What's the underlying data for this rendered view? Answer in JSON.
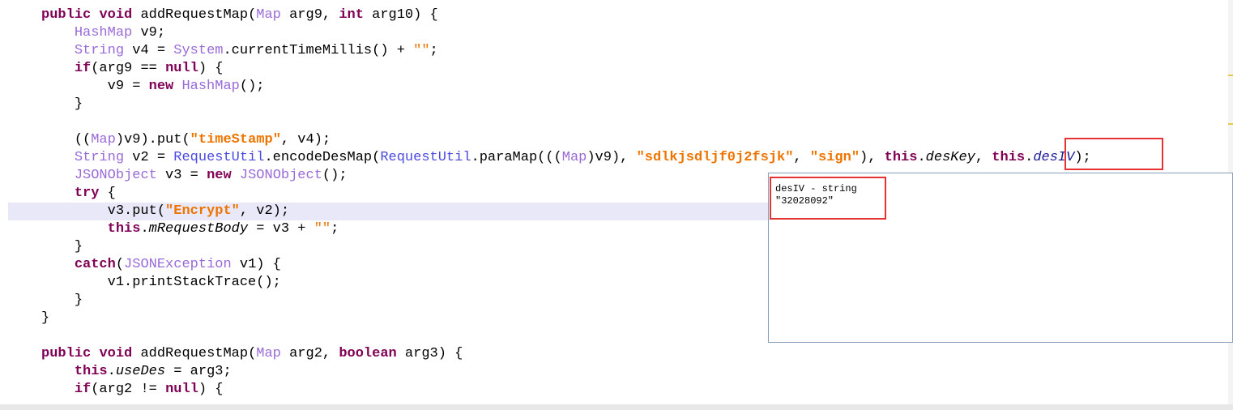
{
  "code_lines": [
    [
      [
        "public",
        "kw"
      ],
      [
        " ",
        ""
      ],
      [
        "void",
        "kw"
      ],
      [
        " addRequestMap(",
        ""
      ],
      [
        "Map",
        "tp"
      ],
      [
        " arg9, ",
        ""
      ],
      [
        "int",
        "kw"
      ],
      [
        " arg10) {",
        ""
      ]
    ],
    [
      [
        "HashMap",
        "tp"
      ],
      [
        " v9;",
        ""
      ]
    ],
    [
      [
        "String",
        "tp"
      ],
      [
        " v4 = ",
        ""
      ],
      [
        "System",
        "tp"
      ],
      [
        ".currentTimeMillis() + ",
        ""
      ],
      [
        "\"\"",
        "sp"
      ],
      [
        ";",
        ""
      ]
    ],
    [
      [
        "if",
        "kw"
      ],
      [
        "(arg9 == ",
        ""
      ],
      [
        "null",
        "kw"
      ],
      [
        ") {",
        ""
      ]
    ],
    [
      [
        "v9 = ",
        ""
      ],
      [
        "new",
        "kw"
      ],
      [
        " ",
        ""
      ],
      [
        "HashMap",
        "tp"
      ],
      [
        "();",
        ""
      ]
    ],
    [
      [
        "}",
        ""
      ]
    ],
    [],
    [
      [
        "((",
        ""
      ],
      [
        "Map",
        "tp"
      ],
      [
        ")v9).put(",
        ""
      ],
      [
        "\"timeStamp\"",
        "st"
      ],
      [
        ", v4);",
        ""
      ]
    ],
    [
      [
        "String",
        "tp"
      ],
      [
        " v2 = ",
        ""
      ],
      [
        "RequestUtil",
        "cl"
      ],
      [
        ".encodeDesMap(",
        ""
      ],
      [
        "RequestUtil",
        "cl"
      ],
      [
        ".paraMap(((",
        ""
      ],
      [
        "Map",
        "tp"
      ],
      [
        ")v9), ",
        ""
      ],
      [
        "\"sdlkjsdljf0j2fsjk\"",
        "st"
      ],
      [
        ", ",
        ""
      ],
      [
        "\"sign\"",
        "st"
      ],
      [
        "), ",
        ""
      ],
      [
        "this",
        "kw"
      ],
      [
        ".",
        ""
      ],
      [
        "desKey",
        "it"
      ],
      [
        ", ",
        ""
      ],
      [
        "this",
        "kw"
      ],
      [
        ".",
        ""
      ],
      [
        "desIV",
        "ip"
      ],
      [
        ");",
        ""
      ]
    ],
    [
      [
        "JSONObject",
        "tp"
      ],
      [
        " v3 = ",
        ""
      ],
      [
        "new",
        "kw"
      ],
      [
        " ",
        ""
      ],
      [
        "JSONObject",
        "tp"
      ],
      [
        "();",
        ""
      ]
    ],
    [
      [
        "try",
        "kw"
      ],
      [
        " {",
        ""
      ]
    ],
    [
      [
        "v3.put(",
        ""
      ],
      [
        "\"Encrypt\"",
        "st"
      ],
      [
        ", v2);",
        ""
      ]
    ],
    [
      [
        "this",
        "kw"
      ],
      [
        ".",
        ""
      ],
      [
        "mRequestBody",
        "it"
      ],
      [
        " = v3 + ",
        ""
      ],
      [
        "\"\"",
        "sp"
      ],
      [
        ";",
        ""
      ]
    ],
    [
      [
        "}",
        ""
      ]
    ],
    [
      [
        "catch",
        "kw"
      ],
      [
        "(",
        ""
      ],
      [
        "JSONException",
        "tp"
      ],
      [
        " v1) {",
        ""
      ]
    ],
    [
      [
        "v1.printStackTrace();",
        ""
      ]
    ],
    [
      [
        "}",
        ""
      ]
    ],
    [
      [
        "}",
        ""
      ]
    ],
    [],
    [
      [
        "public",
        "kw"
      ],
      [
        " ",
        ""
      ],
      [
        "void",
        "kw"
      ],
      [
        " addRequestMap(",
        ""
      ],
      [
        "Map",
        "tp"
      ],
      [
        " arg2, ",
        ""
      ],
      [
        "boolean",
        "kw"
      ],
      [
        " arg3) {",
        ""
      ]
    ],
    [
      [
        "this",
        "kw"
      ],
      [
        ".",
        ""
      ],
      [
        "useDes",
        "it"
      ],
      [
        " = arg3;",
        ""
      ]
    ],
    [
      [
        "if",
        "kw"
      ],
      [
        "(arg2 != ",
        ""
      ],
      [
        "null",
        "kw"
      ],
      [
        ") {",
        ""
      ]
    ]
  ],
  "indents": [
    5,
    9,
    9,
    9,
    13,
    9,
    0,
    9,
    9,
    9,
    9,
    13,
    13,
    9,
    9,
    13,
    9,
    5,
    0,
    5,
    9,
    9
  ],
  "tooltip": {
    "line1": "desIV - string",
    "line2": "\"32028092\""
  }
}
